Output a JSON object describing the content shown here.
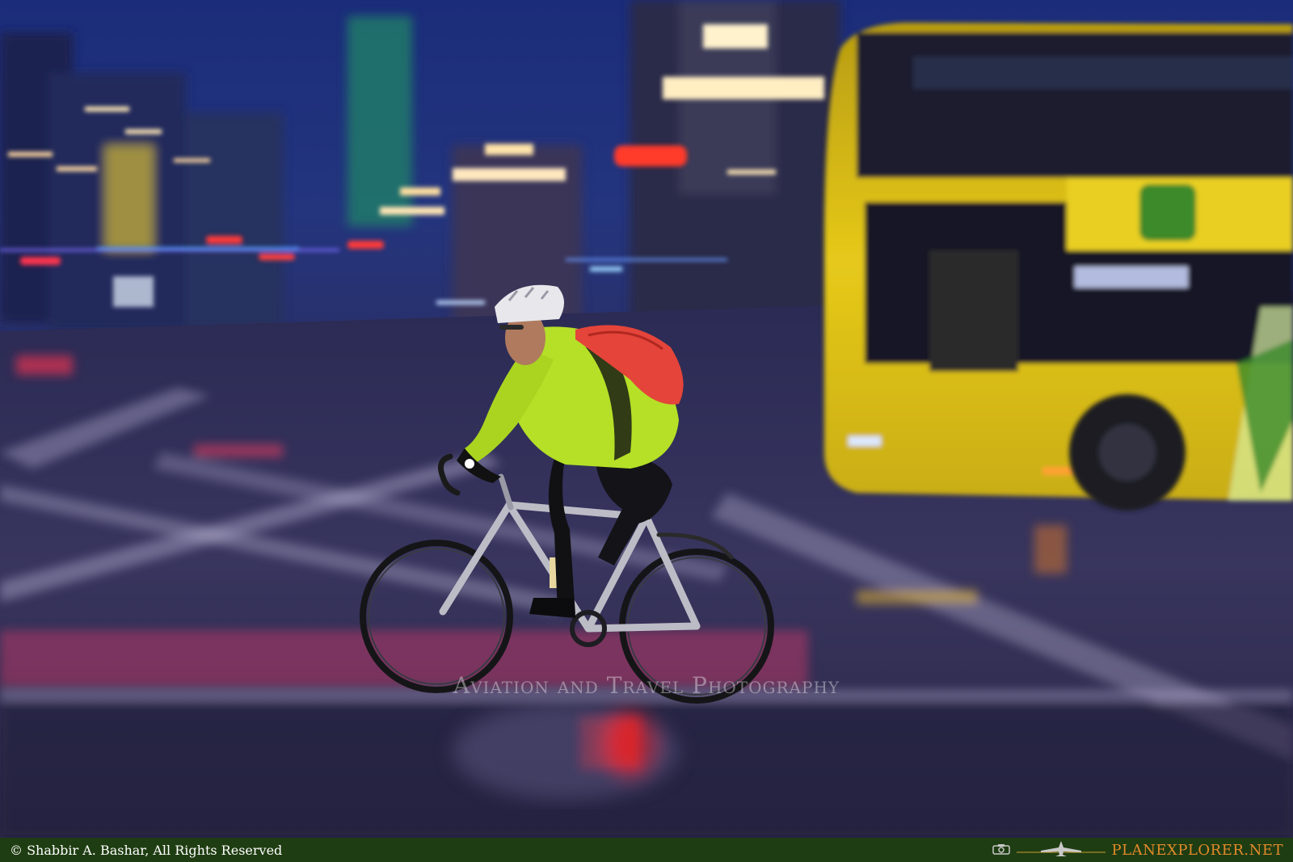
{
  "watermark": {
    "text": "Aviation and Travel Photography"
  },
  "footer": {
    "copyright": "© Shabbir A. Bashar, All Rights Reserved",
    "brand": "PLANEXPLORER.NET",
    "icons": [
      "camera-icon",
      "airplane-icon"
    ]
  },
  "colors": {
    "footer_bg": "#1f3d12",
    "brand": "#e0892a",
    "bus_yellow": "#e0c21a",
    "jacket_green": "#b9e32a",
    "backpack_red": "#e4443a"
  }
}
